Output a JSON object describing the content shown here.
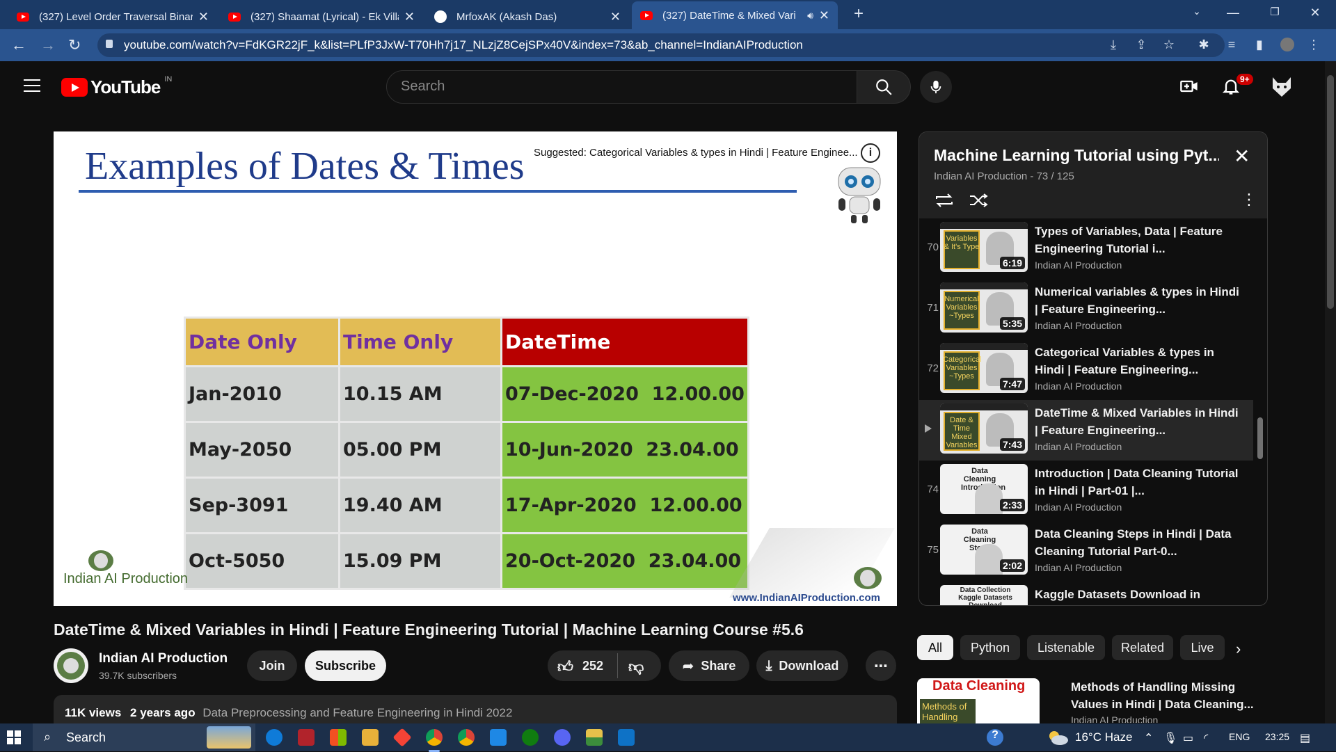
{
  "browser": {
    "tabs": [
      {
        "title": "(327) Level Order Traversal Binary",
        "icon": "youtube-icon",
        "active": false
      },
      {
        "title": "(327) Shaamat (Lyrical) - Ek Villain",
        "icon": "youtube-icon",
        "active": false
      },
      {
        "title": "MrfoxAK (Akash Das)",
        "icon": "github-icon",
        "active": false
      },
      {
        "title": "(327) DateTime & Mixed Vari",
        "icon": "youtube-icon",
        "active": true
      }
    ],
    "url": "youtube.com/watch?v=FdKGR22jF_k&list=PLfP3JxW-T70Hh7j17_NLzjZ8CejSPx40V&index=73&ab_channel=IndianAIProduction"
  },
  "youtube": {
    "logo_text": "YouTube",
    "country_code": "IN",
    "search_placeholder": "Search",
    "notification_count": "9+"
  },
  "player": {
    "slide_title": "Examples of Dates & Times",
    "suggested": "Suggested: Categorical Variables & types in Hindi | Feature Enginee...",
    "info_label": "i",
    "table": {
      "headers": [
        "Date Only",
        "Time Only",
        "DateTime"
      ],
      "rows": [
        [
          "Jan-2010",
          "10.15 AM",
          "07-Dec-2020  12.00.00"
        ],
        [
          "May-2050",
          "05.00 PM",
          "10-Jun-2020  23.04.00"
        ],
        [
          "Sep-3091",
          "19.40 AM",
          "17-Apr-2020  12.00.00"
        ],
        [
          "Oct-5050",
          "15.09 PM",
          "20-Oct-2020  23.04.00"
        ]
      ]
    },
    "brand_left": "Indian AI Production",
    "brand_right": "www.IndianAIProduction.com"
  },
  "video": {
    "title": "DateTime & Mixed Variables in Hindi | Feature Engineering Tutorial | Machine Learning Course #5.6",
    "channel": "Indian AI Production",
    "subscribers": "39.7K subscribers",
    "join_label": "Join",
    "subscribe_label": "Subscribe",
    "likes": "252",
    "share_label": "Share",
    "download_label": "Download",
    "views": "11K views",
    "age": "2 years ago",
    "description_snippet": "Data Preprocessing and Feature Engineering in Hindi 2022"
  },
  "playlist": {
    "title": "Machine Learning Tutorial using Pyt...",
    "subtitle": "Indian AI Production - 73 / 125",
    "items": [
      {
        "index": "70",
        "title": "Types of Variables, Data | Feature Engineering Tutorial i...",
        "channel": "Indian AI Production",
        "duration": "6:19",
        "thumb_text": "Variables & It's Type",
        "current": false
      },
      {
        "index": "71",
        "title": "Numerical variables & types in Hindi | Feature Engineering...",
        "channel": "Indian AI Production",
        "duration": "5:35",
        "thumb_text": "Numerical Variables ~Types",
        "current": false
      },
      {
        "index": "72",
        "title": "Categorical Variables & types in Hindi | Feature Engineering...",
        "channel": "Indian AI Production",
        "duration": "7:47",
        "thumb_text": "Categorical Variables ~Types",
        "current": false
      },
      {
        "index": "",
        "title": "DateTime & Mixed Variables in Hindi | Feature Engineering...",
        "channel": "Indian AI Production",
        "duration": "7:43",
        "thumb_text": "Date & Time Mixed Variables",
        "current": true
      },
      {
        "index": "74",
        "title": "Introduction | Data Cleaning Tutorial in Hindi | Part-01 |...",
        "channel": "Indian AI Production",
        "duration": "2:33",
        "thumb_text": "Data Cleaning Introduction",
        "current": false
      },
      {
        "index": "75",
        "title": "Data Cleaning Steps in Hindi | Data Cleaning Tutorial Part-0...",
        "channel": "Indian AI Production",
        "duration": "2:02",
        "thumb_text": "Data Cleaning Steps",
        "current": false
      },
      {
        "index": "",
        "title": "Kaggle Datasets Download in",
        "channel": "",
        "duration": "",
        "thumb_text": "Data Collection Kaggle Datasets Download",
        "current": false
      }
    ]
  },
  "chips": [
    "All",
    "Python",
    "Listenable",
    "Related",
    "Live"
  ],
  "recommended": {
    "title": "Methods of Handling Missing Values in Hindi | Data Cleaning...",
    "channel": "Indian AI Production",
    "thumb_title": "Data Cleaning",
    "thumb_sub": "Methods of Handling"
  },
  "taskbar": {
    "search_label": "Search",
    "temperature": "16°C  Haze",
    "language": "ENG",
    "time": "23:25"
  }
}
